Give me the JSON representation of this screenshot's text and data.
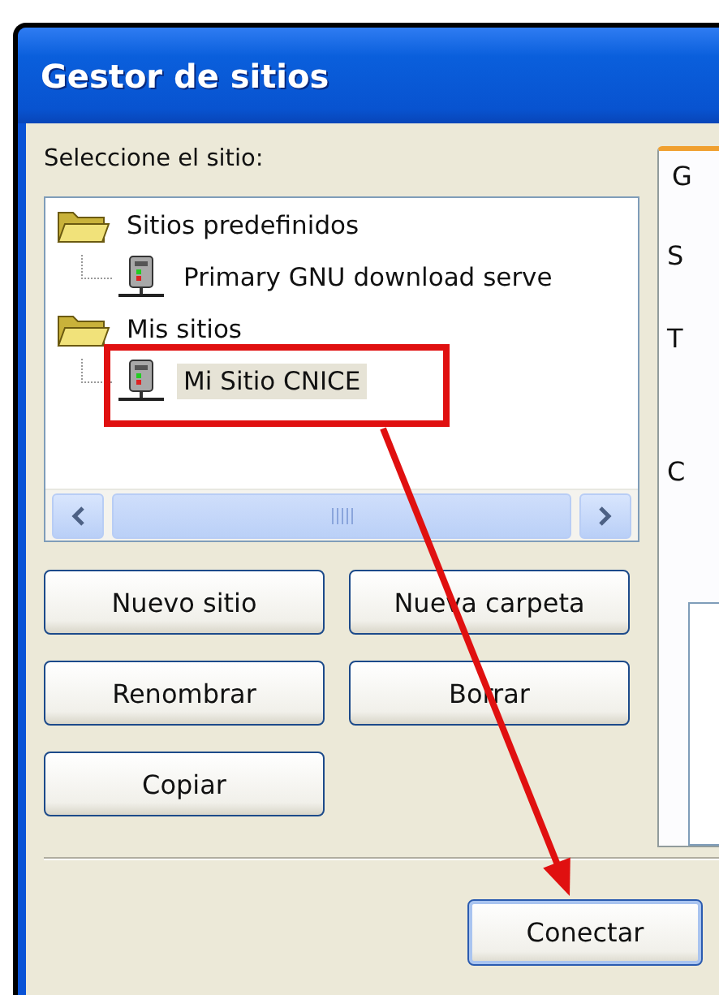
{
  "window": {
    "title": "Gestor de sitios"
  },
  "site_label": "Seleccione el sitio:",
  "tree": [
    {
      "label": "Sitios predefinidos",
      "kind": "folder",
      "expanded": true,
      "selected": false,
      "children": [
        {
          "label": "Primary GNU download serve",
          "kind": "site",
          "selected": false
        }
      ]
    },
    {
      "label": "Mis sitios",
      "kind": "folder",
      "expanded": true,
      "selected": false,
      "children": [
        {
          "label": "Mi Sitio CNICE",
          "kind": "site",
          "selected": true
        }
      ]
    }
  ],
  "buttons": [
    "Nuevo sitio",
    "Nueva carpeta",
    "Renombrar",
    "Borrar",
    "Copiar"
  ],
  "right_panel": {
    "tabs": [
      {
        "label": "G",
        "selected": true
      }
    ],
    "labels": [
      "S",
      "T",
      "C"
    ]
  },
  "connect_button": "Conectar"
}
